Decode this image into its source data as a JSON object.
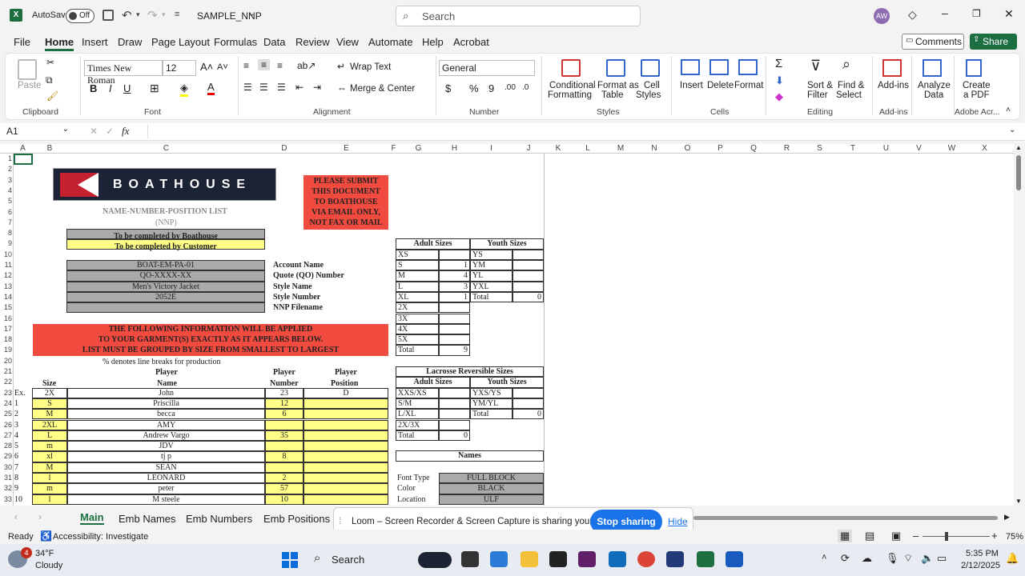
{
  "app": {
    "autosave": "AutoSave",
    "autosave_state": "Off",
    "filename": "SAMPLE_NNP",
    "search_placeholder": "Search",
    "user_initials": "AW"
  },
  "menu": [
    "File",
    "Home",
    "Insert",
    "Draw",
    "Page Layout",
    "Formulas",
    "Data",
    "Review",
    "View",
    "Automate",
    "Help",
    "Acrobat"
  ],
  "comments": "Comments",
  "share": "Share",
  "ribbon": {
    "paste": "Paste",
    "clipboard": "Clipboard",
    "font_name": "Times New Roman",
    "font_size": "12",
    "font": "Font",
    "wrap": "Wrap Text",
    "merge": "Merge & Center",
    "alignment": "Alignment",
    "numfmt": "General",
    "number": "Number",
    "cond1": "Conditional",
    "cond2": "Formatting",
    "fmt1": "Format as",
    "fmt2": "Table",
    "cell1": "Cell",
    "cell2": "Styles",
    "styles": "Styles",
    "insert": "Insert",
    "delete": "Delete",
    "format": "Format",
    "cells": "Cells",
    "sort1": "Sort &",
    "sort2": "Filter",
    "find1": "Find &",
    "find2": "Select",
    "editing": "Editing",
    "addins": "Add-ins",
    "addins_grp": "Add-ins",
    "analyze1": "Analyze",
    "analyze2": "Data",
    "pdf1": "Create",
    "pdf2": "a PDF",
    "acrobat": "Adobe Acr..."
  },
  "namebox": "A1",
  "cols": [
    "A",
    "B",
    "C",
    "D",
    "E",
    "F",
    "G",
    "H",
    "I",
    "J",
    "K",
    "L",
    "M",
    "N",
    "O",
    "P",
    "Q",
    "R",
    "S",
    "T",
    "U",
    "V",
    "W",
    "X"
  ],
  "sheet": {
    "logo": "BOATHOUSE",
    "title1": "NAME-NUMBER-POSITION LIST",
    "title2": "(NNP)",
    "by_bh": "To be completed by Boathouse",
    "by_cust": "To be completed by Customer",
    "notice": [
      "PLEASE SUBMIT",
      "THIS DOCUMENT",
      "TO BOATHOUSE",
      "VIA EMAIL ONLY,",
      "NOT FAX OR MAIL"
    ],
    "info_vals": [
      "BOAT-EM-PA-01",
      "QO-XXXX-XX",
      "Men's Victory Jacket",
      "2052E",
      ""
    ],
    "info_labels": [
      "Account Name",
      "Quote (QO) Number",
      "Style Name",
      "Style Number",
      "NNP Filename"
    ],
    "warn": [
      "THE FOLLOWING INFORMATION WILL BE APPLIED",
      "TO YOUR GARMENT(S) EXACTLY AS IT APPEARS BELOW.",
      "LIST MUST BE GROUPED BY SIZE FROM SMALLEST TO LARGEST"
    ],
    "pct": "% denotes line breaks for production",
    "hdr": {
      "size": "Size",
      "player": "Player",
      "name": "Name",
      "number": "Number",
      "position": "Position"
    },
    "players": [
      [
        "Ex.",
        "2X",
        "John",
        "23",
        "D"
      ],
      [
        "1",
        "S",
        "Priscilla",
        "12",
        ""
      ],
      [
        "2",
        "M",
        "becca",
        "6",
        ""
      ],
      [
        "3",
        "2XL",
        "AMY",
        "",
        ""
      ],
      [
        "4",
        "L",
        "Andrew Vargo",
        "35",
        ""
      ],
      [
        "5",
        "m",
        "JDV",
        "",
        ""
      ],
      [
        "6",
        "xl",
        "tj p",
        "8",
        ""
      ],
      [
        "7",
        "M",
        "SEAN",
        "",
        ""
      ],
      [
        "8",
        "l",
        "LEONARD",
        "2",
        ""
      ],
      [
        "9",
        "m",
        "peter",
        "57",
        ""
      ],
      [
        "10",
        "l",
        "M steele",
        "10",
        ""
      ]
    ],
    "adult_hdr": "Adult Sizes",
    "youth_hdr": "Youth Sizes",
    "adult": [
      [
        "XS",
        ""
      ],
      [
        "S",
        "1"
      ],
      [
        "M",
        "4"
      ],
      [
        "L",
        "3"
      ],
      [
        "XL",
        "1"
      ],
      [
        "2X",
        ""
      ],
      [
        "3X",
        ""
      ],
      [
        "4X",
        ""
      ],
      [
        "5X",
        ""
      ],
      [
        "Total",
        "9"
      ]
    ],
    "youth": [
      [
        "YS",
        ""
      ],
      [
        "YM",
        ""
      ],
      [
        "YL",
        ""
      ],
      [
        "YXL",
        ""
      ],
      [
        "Total",
        "0"
      ]
    ],
    "lax_hdr": "Lacrosse Reversible Sizes",
    "lax_adult": [
      [
        "XXS/XS",
        ""
      ],
      [
        "S/M",
        ""
      ],
      [
        "L/XL",
        ""
      ],
      [
        "2X/3X",
        ""
      ],
      [
        "Total",
        "0"
      ]
    ],
    "lax_youth": [
      [
        "YXS/YS",
        ""
      ],
      [
        "YM/YL",
        ""
      ],
      [
        "Total",
        "0"
      ]
    ],
    "names_hdr": "Names",
    "names": [
      [
        "Font Type",
        "FULL BLOCK"
      ],
      [
        "Color",
        "BLACK"
      ],
      [
        "Location",
        "ULF"
      ]
    ]
  },
  "tabs": [
    "Main",
    "Emb Names",
    "Emb Numbers",
    "Emb Positions"
  ],
  "share_bar": {
    "text": "Loom – Screen Recorder & Screen Capture is sharing your screen.",
    "stop": "Stop sharing",
    "hide": "Hide"
  },
  "status": {
    "ready": "Ready",
    "access": "Accessibility: Investigate",
    "zoom": "75%"
  },
  "taskbar": {
    "temp": "34°F",
    "weather": "Cloudy",
    "search": "Search",
    "time": "5:35 PM",
    "date": "2/12/2025",
    "badge": "4"
  }
}
